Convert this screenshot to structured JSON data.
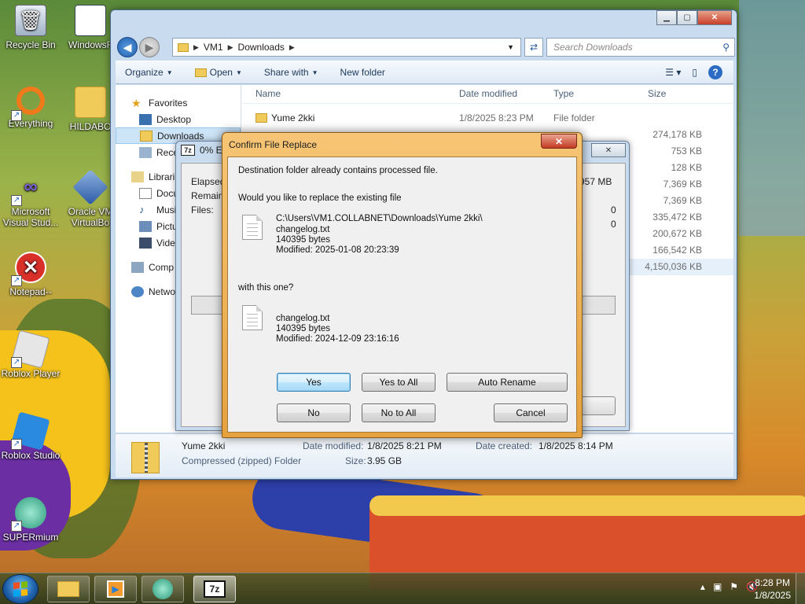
{
  "desktop": {
    "icons": [
      {
        "label": "Recycle Bin"
      },
      {
        "label": "WindowsF"
      },
      {
        "label": "Everything"
      },
      {
        "label": "HILDABO"
      },
      {
        "label": "Microsoft Visual Stud..."
      },
      {
        "label": "Oracle VM VirtualBo"
      },
      {
        "label": "Notepad--"
      },
      {
        "label": "Roblox Player"
      },
      {
        "label": "Roblox Studio"
      },
      {
        "label": "SUPERmium"
      }
    ]
  },
  "explorer": {
    "address": {
      "crumbs": [
        "VM1",
        "Downloads"
      ]
    },
    "search": {
      "placeholder": "Search Downloads"
    },
    "toolbar": {
      "organize": "Organize",
      "open": "Open",
      "share_with": "Share with",
      "new_folder": "New folder"
    },
    "nav": {
      "favorites": "Favorites",
      "desktop": "Desktop",
      "downloads": "Downloads",
      "recent": "Rece",
      "libraries": "Librari",
      "documents": "Docu",
      "music": "Musi",
      "pictures": "Pictu",
      "videos": "Vide",
      "computer": "Comp",
      "network": "Netwo"
    },
    "columns": {
      "name": "Name",
      "date": "Date modified",
      "type": "Type",
      "size": "Size"
    },
    "rows": [
      {
        "name": "Yume 2kki",
        "date": "1/8/2025 8:23 PM",
        "type": "File folder",
        "size": ""
      },
      {
        "name": "",
        "date": "",
        "type": "",
        "size": "274,178 KB"
      },
      {
        "name": "",
        "date": "",
        "type": "",
        "size": "753 KB"
      },
      {
        "name": "",
        "date": "",
        "type": "",
        "size": "128 KB"
      },
      {
        "name": "",
        "date": "",
        "type": "",
        "size": "7,369 KB"
      },
      {
        "name": "",
        "date": "",
        "type": "",
        "size": "7,369 KB"
      },
      {
        "name": "",
        "date": "",
        "type": "",
        "size": "335,472 KB"
      },
      {
        "name": "",
        "date": "",
        "type": "",
        "size": "200,672 KB"
      },
      {
        "name": "",
        "date": "",
        "type": "",
        "size": "166,542 KB"
      },
      {
        "name": "",
        "date": "",
        "type": "",
        "size": "4,150,036 KB"
      }
    ],
    "details": {
      "name": "Yume 2kki",
      "kind": "Compressed (zipped) Folder",
      "date_modified_label": "Date modified:",
      "date_modified": "1/8/2025 8:21 PM",
      "size_label": "Size:",
      "size": "3.95 GB",
      "date_created_label": "Date created:",
      "date_created": "1/8/2025 8:14 PM"
    }
  },
  "sevenzip": {
    "logo": "7z",
    "title": "0% Ex",
    "elapsed_label": "Elapsed",
    "remaining_label": "Remainin",
    "files_label": "Files:",
    "size_value": "957 MB",
    "zero1": "0",
    "zero2": "0"
  },
  "dialog": {
    "title": "Confirm File Replace",
    "close": "✕",
    "message": "Destination folder already contains processed file.",
    "question": "Would you like to replace the existing file",
    "existing": {
      "path": "C:\\Users\\VM1.COLLABNET\\Downloads\\Yume 2kki\\",
      "name": "changelog.txt",
      "size": "140395 bytes",
      "modified": "Modified: 2025-01-08 20:23:39"
    },
    "with_label": "with this one?",
    "incoming": {
      "name": "changelog.txt",
      "size": "140395 bytes",
      "modified": "Modified: 2024-12-09 23:16:16"
    },
    "buttons": {
      "yes": "Yes",
      "yes_all": "Yes to All",
      "auto_rename": "Auto Rename",
      "no": "No",
      "no_all": "No to All",
      "cancel": "Cancel"
    }
  },
  "taskbar": {
    "apps": [
      "explorer-icon",
      "media-player-icon",
      "supermium-icon",
      "7zip-icon"
    ],
    "sevenzip_label": "7z",
    "time": "8:28 PM",
    "date": "1/8/2025"
  },
  "colors": {
    "dialog_frame": "#e6a23e",
    "selection": "#cde4f7",
    "default_button": "#3c7fb1"
  }
}
